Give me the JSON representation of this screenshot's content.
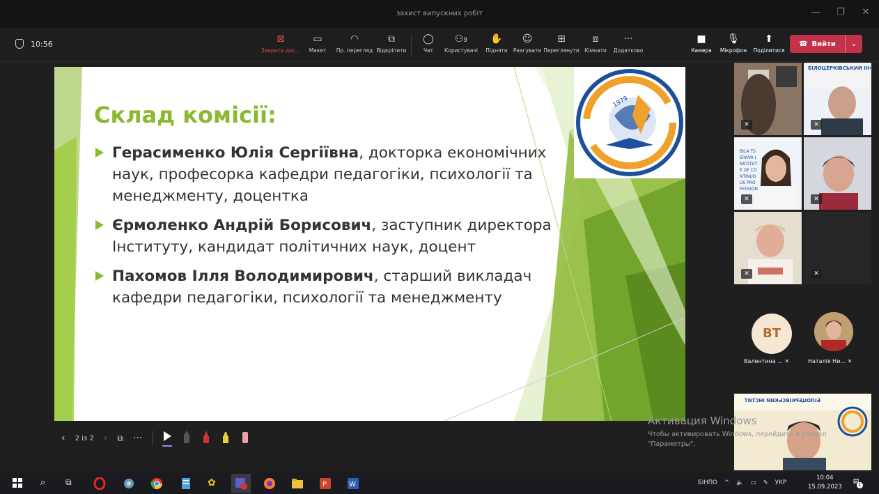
{
  "window": {
    "title": "захист випускних робіт"
  },
  "meeting": {
    "elapsed": "10:56"
  },
  "toolbar": {
    "left_tools": [
      {
        "label": "Закрити дос...",
        "icon": "stop-share-icon"
      },
      {
        "label": "Макет",
        "icon": "layout-icon"
      },
      {
        "label": "Пр. перегляд",
        "icon": "view-icon"
      },
      {
        "label": "Відкріпити",
        "icon": "popout-icon"
      }
    ],
    "mid_tools": [
      {
        "label": "Чат",
        "icon": "chat-icon"
      },
      {
        "label": "Користувачі",
        "icon": "people-icon",
        "badge": "9"
      },
      {
        "label": "Підняти",
        "icon": "raise-hand-icon"
      },
      {
        "label": "Реагувати",
        "icon": "emoji-icon"
      },
      {
        "label": "Переглянути",
        "icon": "grid-icon"
      },
      {
        "label": "Кімнати",
        "icon": "rooms-icon"
      },
      {
        "label": "Додатково",
        "icon": "more-icon"
      }
    ],
    "right_tools": [
      {
        "label": "Камера",
        "icon": "camera-icon"
      },
      {
        "label": "Мікрофон",
        "icon": "microphone-icon"
      },
      {
        "label": "Поділитися",
        "icon": "share-icon"
      }
    ],
    "leave_label": "Вийти",
    "leave_color": "#c4314b"
  },
  "slide": {
    "title": "Склад комісії:",
    "accent_color": "#8cb832",
    "bullets": [
      {
        "name": "Герасименко Юлія Сергіївна",
        "rest": ", докторка економічних наук, професорка кафедри педагогіки, психології та менеджменту, доцентка"
      },
      {
        "name": "Єрмоленко Андрій Борисович",
        "rest": ", заступник директора Інституту, кандидат політичних наук, доцент"
      },
      {
        "name": "Пахомов Ілля Володимирович",
        "rest": ", старший викладач кафедри педагогіки, психології та менеджменту"
      }
    ],
    "logo_year": "1979"
  },
  "slide_nav": {
    "page": "2 із 2"
  },
  "watermark": {
    "line1": "Активация Windows",
    "line2": "Чтобы активировать Windows, перейдите в раздел",
    "line3": "\"Параметры\"."
  },
  "participants": {
    "banner_text": "БІЛОЦЕРКІВСЬКИЙ ІНСТИТУТ НЕПЕРЕРВНОЇ ПРОФЕСІЙНОЇ ОСВІТИ",
    "banner_en": "BILA TSERKVA INSTITUTE OF CONTINUOUS PROFESSIONAL EDUCATION",
    "vt_initials": "ВТ",
    "vt_name": "Валентина ...",
    "nh_name": "Наталія Ни..."
  },
  "taskbar": {
    "lang_app": "БІНПО",
    "lang": "УКР",
    "time": "10:04",
    "date": "15.09.2023",
    "notif_count": "1"
  }
}
